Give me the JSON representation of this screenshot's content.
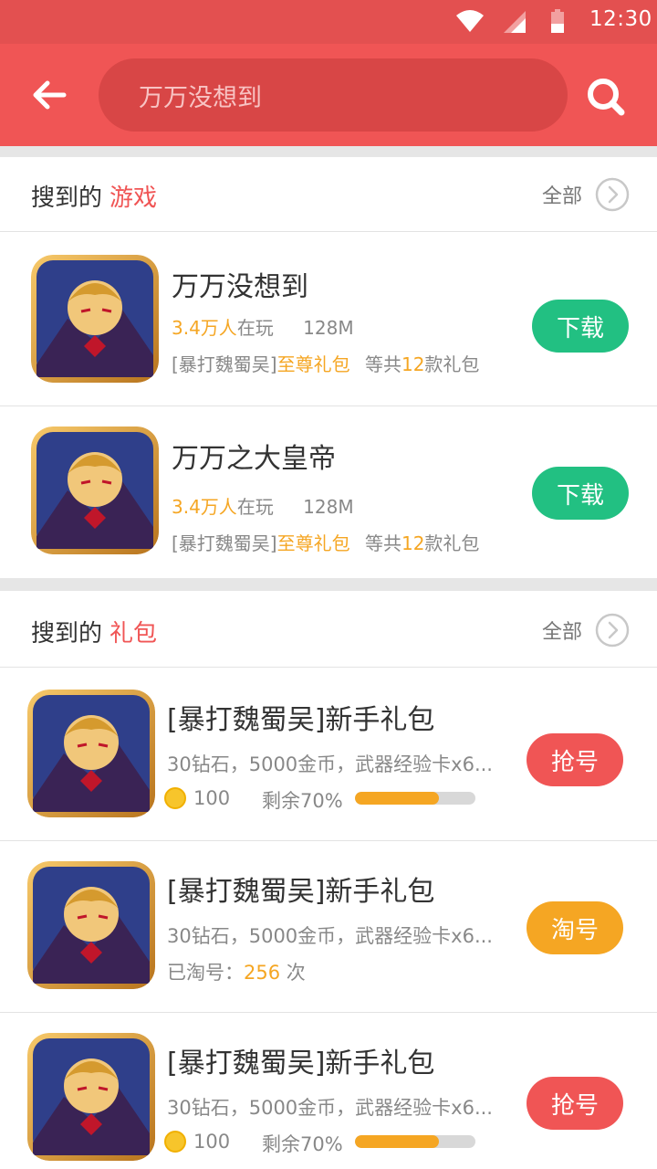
{
  "status_bar": {
    "time": "12:30"
  },
  "search": {
    "value": "万万没想到"
  },
  "games_section": {
    "prefix": "搜到的",
    "accent": "游戏",
    "see_all": "全部",
    "items": [
      {
        "title": "万万没想到",
        "players_count": "3.4万人",
        "players_suffix": "在玩",
        "size": "128M",
        "gift_prefix": "[暴打魏蜀吴]",
        "gift_highlight": "至尊礼包",
        "gift_total_prefix": "等共",
        "gift_total_count": "12",
        "gift_total_suffix": "款礼包",
        "button": "下载"
      },
      {
        "title": "万万之大皇帝",
        "players_count": "3.4万人",
        "players_suffix": "在玩",
        "size": "128M",
        "gift_prefix": "[暴打魏蜀吴]",
        "gift_highlight": "至尊礼包",
        "gift_total_prefix": "等共",
        "gift_total_count": "12",
        "gift_total_suffix": "款礼包",
        "button": "下载"
      }
    ]
  },
  "gifts_section": {
    "prefix": "搜到的",
    "accent": "礼包",
    "see_all": "全部",
    "items": [
      {
        "title": "[暴打魏蜀吴]新手礼包",
        "desc": "30钻石，5000金币，武器经验卡x6...",
        "coins": "100",
        "remain_label": "剩余70%",
        "remain": 0.7,
        "button": "抢号"
      },
      {
        "title": "[暴打魏蜀吴]新手礼包",
        "desc": "30钻石，5000金币，武器经验卡x6...",
        "count_prefix": "已淘号：",
        "count_value": "256",
        "count_suffix": " 次",
        "button": "淘号"
      },
      {
        "title": "[暴打魏蜀吴]新手礼包",
        "desc": "30钻石，5000金币，武器经验卡x6...",
        "coins": "100",
        "remain_label": "剩余70%",
        "remain": 0.7,
        "button": "抢号"
      }
    ]
  },
  "colors": {
    "brand": "#f05555",
    "green": "#22c082",
    "orange": "#f5a623"
  }
}
